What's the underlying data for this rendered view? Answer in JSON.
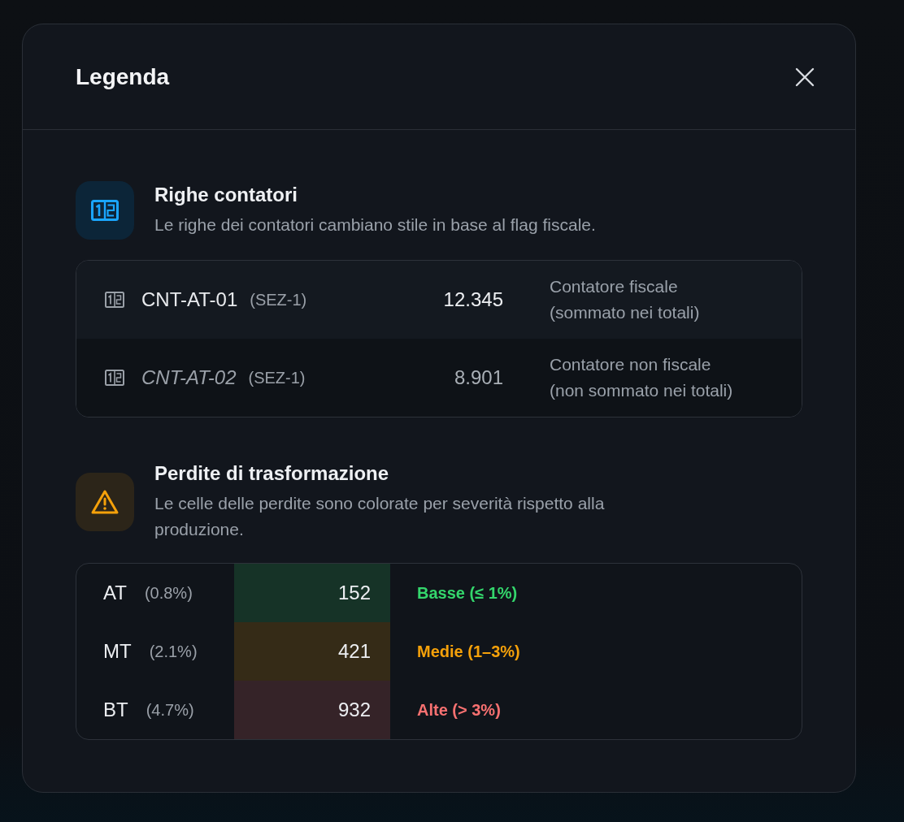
{
  "dialog": {
    "title": "Legenda"
  },
  "sections": [
    {
      "kind": "meters",
      "title": "Righe contatori",
      "description": "Le righe dei contatori cambiano stile in base al flag fiscale.",
      "rows": [
        {
          "name": "CNT-AT-01",
          "section": "(SEZ-1)",
          "value": "12.345",
          "note": [
            "Contatore fiscale",
            "(sommato nei totali)"
          ],
          "fiscal": true
        },
        {
          "name": "CNT-AT-02",
          "section": "(SEZ-1)",
          "value": "8.901",
          "note": [
            "Contatore non fiscale",
            "(non sommato nei totali)"
          ],
          "fiscal": false
        }
      ]
    },
    {
      "kind": "losses",
      "title": "Perdite di trasformazione",
      "description": "Le celle delle perdite sono colorate per severità rispetto alla produzione.",
      "rows": [
        {
          "label": "AT",
          "share": "(0.8%)",
          "value": "152",
          "band": "Basse (≤ 1%)",
          "color": "#34d66c"
        },
        {
          "label": "MT",
          "share": "(2.1%)",
          "value": "421",
          "band": "Medie (1–3%)",
          "color": "#f5a10a"
        },
        {
          "label": "BT",
          "share": "(4.7%)",
          "value": "932",
          "band": "Alte (> 3%)",
          "color": "#f87171"
        }
      ]
    }
  ]
}
